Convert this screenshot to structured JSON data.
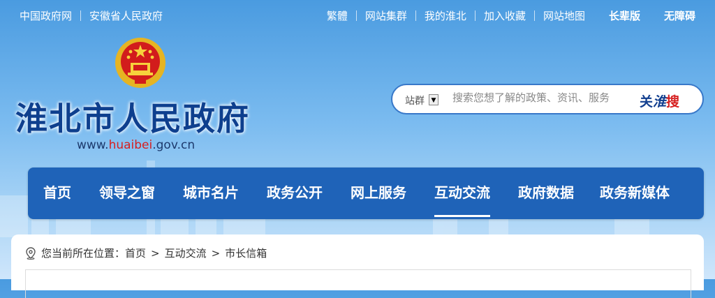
{
  "top_left_links": [
    "中国政府网",
    "安徽省人民政府"
  ],
  "top_right_links": [
    "繁體",
    "网站集群",
    "我的淮北",
    "加入收藏",
    "网站地图"
  ],
  "top_right_bold": [
    "长辈版",
    "无障碍"
  ],
  "site": {
    "title": "淮北市人民政府",
    "url_prefix": "www.",
    "url_highlight": "huaibei",
    "url_suffix": ".gov.cn"
  },
  "search": {
    "scope_label": "站群",
    "placeholder": "搜索您想了解的政策、资讯、服务",
    "button_part1": "关",
    "button_part2": "淮",
    "button_part3": "搜"
  },
  "nav": {
    "items": [
      "首页",
      "领导之窗",
      "城市名片",
      "政务公开",
      "网上服务",
      "互动交流",
      "政府数据",
      "政务新媒体"
    ],
    "active_index": 5
  },
  "breadcrumb": {
    "prefix": "您当前所在位置：",
    "items": [
      "首页",
      "互动交流",
      "市长信箱"
    ],
    "separator": ">"
  },
  "colors": {
    "nav_bg": "#1f63b8",
    "title": "#0e3f8e",
    "highlight_red": "#d61f1f"
  }
}
